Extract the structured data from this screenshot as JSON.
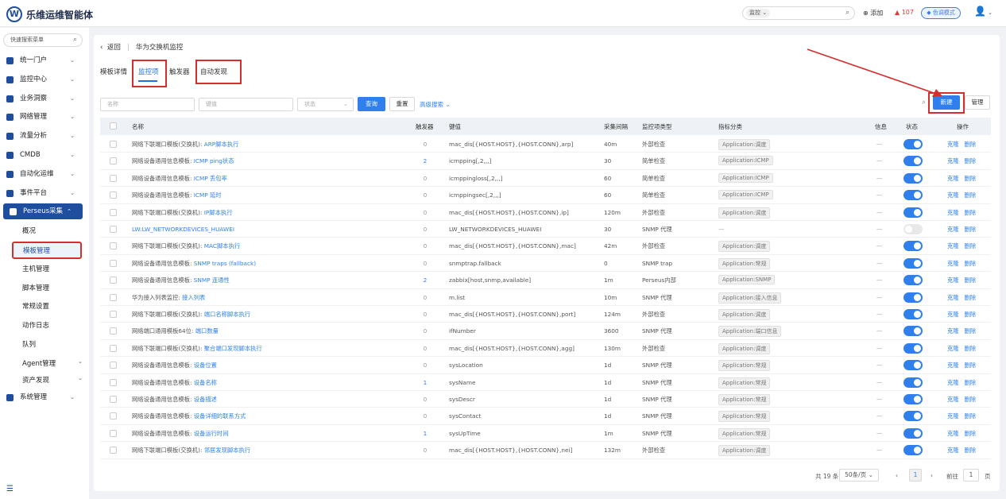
{
  "header": {
    "logo_text": "W",
    "brand": "乐维运维智能体",
    "search_scope": "监控",
    "add_label": "添加",
    "alarm_count": "107",
    "skin_label": "色调模式"
  },
  "sidebar": {
    "search_placeholder": "快速搜索菜单",
    "items": [
      {
        "label": "统一门户"
      },
      {
        "label": "监控中心"
      },
      {
        "label": "业务洞察"
      },
      {
        "label": "网络管理"
      },
      {
        "label": "流量分析"
      },
      {
        "label": "CMDB"
      },
      {
        "label": "自动化运维"
      },
      {
        "label": "事件平台"
      },
      {
        "label": "Perseus采集"
      },
      {
        "label": "系统管理"
      }
    ],
    "sub_items": [
      {
        "label": "概况"
      },
      {
        "label": "模板管理"
      },
      {
        "label": "主机管理"
      },
      {
        "label": "脚本管理"
      },
      {
        "label": "常规设置"
      },
      {
        "label": "动作日志"
      },
      {
        "label": "队列"
      },
      {
        "label": "Agent管理"
      },
      {
        "label": "资产发现"
      }
    ]
  },
  "main": {
    "back_label": "返回",
    "page_title": "华为交换机监控",
    "tabs": [
      {
        "label": "模板详情"
      },
      {
        "label": "监控项"
      },
      {
        "label": "触发器"
      },
      {
        "label": "自动发现"
      }
    ],
    "filters": {
      "name_placeholder": "名称",
      "key_placeholder": "键值",
      "status_placeholder": "状态"
    },
    "query_label": "查询",
    "reset_label": "重置",
    "advanced_label": "高级搜索",
    "new_label": "新建",
    "manage_label": "管理",
    "columns": [
      "名称",
      "触发器",
      "键值",
      "采集间隔",
      "监控项类型",
      "指标分类",
      "信息",
      "状态",
      "操作"
    ],
    "op_clone": "克隆",
    "op_delete": "删除",
    "rows": [
      {
        "prefix": "网络下联端口模板(交换机): ",
        "link": "ARP脚本执行",
        "trig": "0",
        "key": "mac_dis[{HOST.HOST},{HOST.CONN},arp]",
        "interval": "40m",
        "type": "外部检查",
        "category": "Application:调度",
        "info": "—",
        "enabled": true
      },
      {
        "prefix": "网络设备通用信息模板: ",
        "link": "ICMP ping状态",
        "trig": "2",
        "key": "icmpping[,2,,,]",
        "interval": "30",
        "type": "简单检查",
        "category": "Application:ICMP",
        "info": "—",
        "enabled": true
      },
      {
        "prefix": "网络设备通用信息模板: ",
        "link": "ICMP 丢包率",
        "trig": "0",
        "key": "icmppingloss[,2,,,]",
        "interval": "60",
        "type": "简单检查",
        "category": "Application:ICMP",
        "info": "—",
        "enabled": true
      },
      {
        "prefix": "网络设备通用信息模板: ",
        "link": "ICMP 延时",
        "trig": "0",
        "key": "icmppingsec[,2,,,]",
        "interval": "60",
        "type": "简单检查",
        "category": "Application:ICMP",
        "info": "—",
        "enabled": true
      },
      {
        "prefix": "网络下联端口模板(交换机): ",
        "link": "IP脚本执行",
        "trig": "0",
        "key": "mac_dis[{HOST.HOST},{HOST.CONN},ip]",
        "interval": "120m",
        "type": "外部检查",
        "category": "Application:调度",
        "info": "—",
        "enabled": true
      },
      {
        "prefix": "",
        "link": "LW:LW_NETWORKDEVICES_HUAWEI",
        "trig": "0",
        "key": "LW_NETWORKDEVICES_HUAWEI",
        "interval": "30",
        "type": "SNMP 代理",
        "category": "—",
        "info": "—",
        "enabled": false
      },
      {
        "prefix": "网络下联端口模板(交换机): ",
        "link": "MAC脚本执行",
        "trig": "0",
        "key": "mac_dis[{HOST.HOST},{HOST.CONN},mac]",
        "interval": "42m",
        "type": "外部检查",
        "category": "Application:调度",
        "info": "—",
        "enabled": true
      },
      {
        "prefix": "网络设备通用信息模板: ",
        "link": "SNMP traps (fallback)",
        "trig": "0",
        "key": "snmptrap.fallback",
        "interval": "0",
        "type": "SNMP trap",
        "category": "Application:常规",
        "info": "—",
        "enabled": true
      },
      {
        "prefix": "网络设备通用信息模板: ",
        "link": "SNMP 连通性",
        "trig": "2",
        "key": "zabbix[host,snmp,available]",
        "interval": "1m",
        "type": "Perseus内部",
        "category": "Application:SNMP",
        "info": "—",
        "enabled": true
      },
      {
        "prefix": "华为接入列表监控: ",
        "link": "接入列表",
        "trig": "0",
        "key": "m.list",
        "interval": "10m",
        "type": "SNMP 代理",
        "category": "Application:接入信息",
        "info": "—",
        "enabled": true
      },
      {
        "prefix": "网络下联端口模板(交换机): ",
        "link": "端口名称脚本执行",
        "trig": "0",
        "key": "mac_dis[{HOST.HOST},{HOST.CONN},port]",
        "interval": "124m",
        "type": "外部检查",
        "category": "Application:调度",
        "info": "—",
        "enabled": true
      },
      {
        "prefix": "网络端口通用模板64位: ",
        "link": "端口数量",
        "trig": "0",
        "key": "ifNumber",
        "interval": "3600",
        "type": "SNMP 代理",
        "category": "Application:端口信息",
        "info": "—",
        "enabled": true
      },
      {
        "prefix": "网络下联端口模板(交换机): ",
        "link": "聚合端口发现脚本执行",
        "trig": "0",
        "key": "mac_dis[{HOST.HOST},{HOST.CONN},agg]",
        "interval": "130m",
        "type": "外部检查",
        "category": "Application:调度",
        "info": "—",
        "enabled": true
      },
      {
        "prefix": "网络设备通用信息模板: ",
        "link": "设备位置",
        "trig": "0",
        "key": "sysLocation",
        "interval": "1d",
        "type": "SNMP 代理",
        "category": "Application:常规",
        "info": "—",
        "enabled": true
      },
      {
        "prefix": "网络设备通用信息模板: ",
        "link": "设备名称",
        "trig": "1",
        "key": "sysName",
        "interval": "1d",
        "type": "SNMP 代理",
        "category": "Application:常规",
        "info": "—",
        "enabled": true
      },
      {
        "prefix": "网络设备通用信息模板: ",
        "link": "设备描述",
        "trig": "0",
        "key": "sysDescr",
        "interval": "1d",
        "type": "SNMP 代理",
        "category": "Application:常规",
        "info": "—",
        "enabled": true
      },
      {
        "prefix": "网络设备通用信息模板: ",
        "link": "设备详细的联系方式",
        "trig": "0",
        "key": "sysContact",
        "interval": "1d",
        "type": "SNMP 代理",
        "category": "Application:常规",
        "info": "—",
        "enabled": true
      },
      {
        "prefix": "网络设备通用信息模板: ",
        "link": "设备运行时间",
        "trig": "1",
        "key": "sysUpTime",
        "interval": "1m",
        "type": "SNMP 代理",
        "category": "Application:常规",
        "info": "—",
        "enabled": true
      },
      {
        "prefix": "网络下联端口模板(交换机): ",
        "link": "邻居发现脚本执行",
        "trig": "0",
        "key": "mac_dis[{HOST.HOST},{HOST.CONN},nei]",
        "interval": "132m",
        "type": "外部检查",
        "category": "Application:调度",
        "info": "—",
        "enabled": true
      }
    ],
    "pagination": {
      "total": "共 19 条",
      "page_size": "50条/页",
      "current": "1",
      "goto_label": "前往",
      "goto_value": "1",
      "page_suffix": "页"
    }
  }
}
